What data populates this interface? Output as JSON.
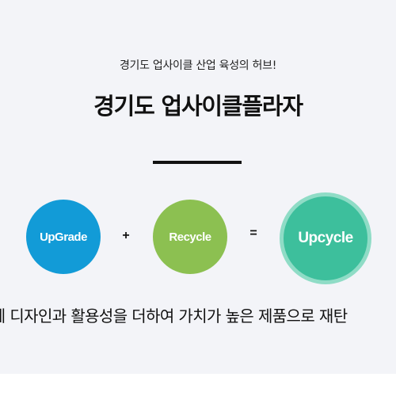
{
  "hero": {
    "subtitle": "경기도 업사이클 산업 육성의 허브!",
    "title": "경기도 업사이클플라자",
    "formula": {
      "upgrade_label": "UpGrade",
      "plus": "+",
      "recycle_label": "Recycle",
      "equals": "=",
      "upcycle_label": "Upcycle"
    },
    "description": "품에 디자인과 활용성을 더하여 가치가 높은 제품으로 재탄"
  },
  "colors": {
    "upgrade": "#129bd7",
    "recycle": "#8cc051",
    "upcycle": "#3dbf9c",
    "upcycle_ring": "#8fdcc6",
    "hero_background": "#f3f4f8"
  }
}
